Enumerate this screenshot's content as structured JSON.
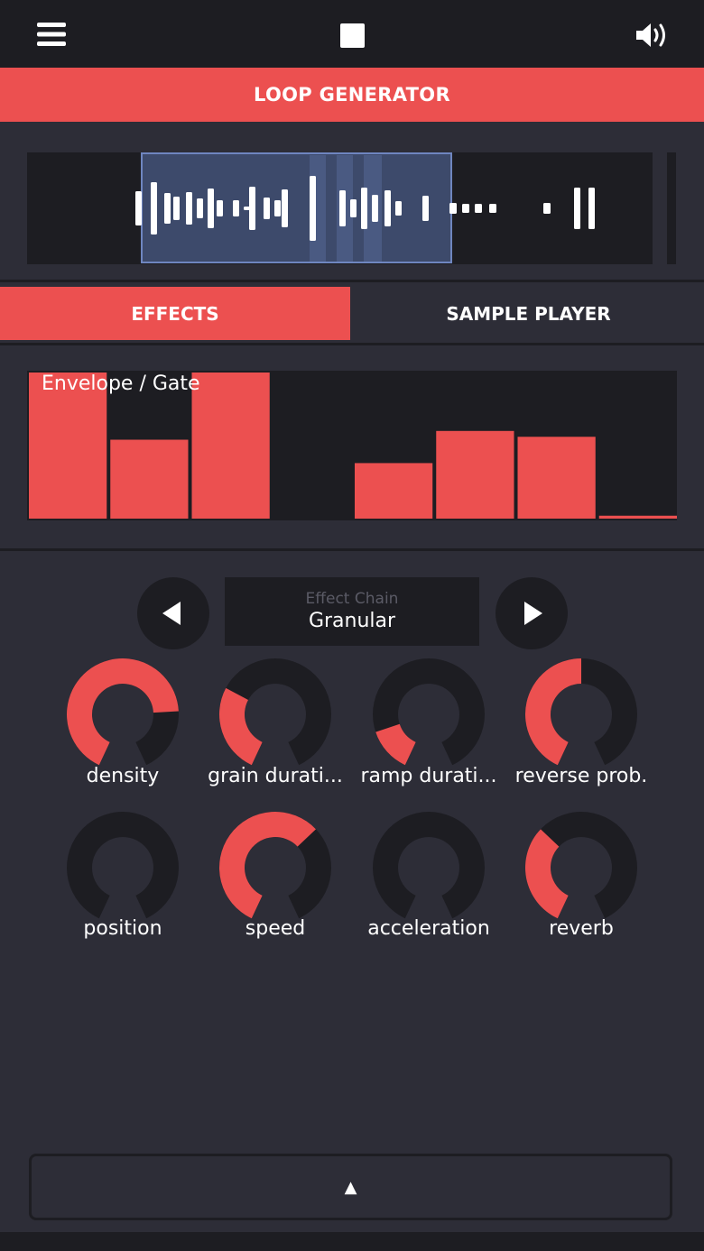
{
  "topbar": {
    "menu_icon": "hamburger-menu-icon",
    "stop_icon": "stop-square-icon",
    "volume_icon": "speaker-volume-icon"
  },
  "title": "LOOP GENERATOR",
  "tabs": [
    {
      "label": "EFFECTS",
      "active": true
    },
    {
      "label": "SAMPLE PLAYER",
      "active": false
    }
  ],
  "envelope": {
    "title": "Envelope / Gate",
    "bars": [
      1.0,
      0.54,
      1.0,
      0.0,
      0.38,
      0.6,
      0.56,
      0.02
    ]
  },
  "effect_chain": {
    "label": "Effect Chain",
    "value": "Granular",
    "prev_icon": "triangle-left-icon",
    "next_icon": "triangle-right-icon"
  },
  "knobs": [
    {
      "label": "density",
      "value": 0.78
    },
    {
      "label": "grain durati...",
      "value": 0.3
    },
    {
      "label": "ramp durati...",
      "value": 0.15
    },
    {
      "label": "reverse prob.",
      "value": 0.5
    },
    {
      "label": "position",
      "value": 0.0
    },
    {
      "label": "speed",
      "value": 0.65
    },
    {
      "label": "acceleration",
      "value": 0.0
    },
    {
      "label": "reverb",
      "value": 0.35
    }
  ],
  "bottom": {
    "arrow": "▲"
  },
  "colors": {
    "accent": "#ec5050",
    "panel": "#1d1d22",
    "background": "#2d2d37",
    "selection": "#3d4a6b"
  }
}
